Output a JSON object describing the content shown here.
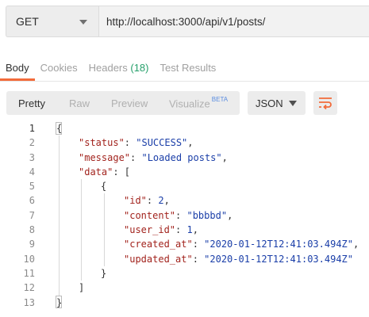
{
  "request": {
    "method": "GET",
    "url": "http://localhost:3000/api/v1/posts/"
  },
  "tabs": [
    {
      "label": "Body"
    },
    {
      "label": "Cookies"
    },
    {
      "label": "Headers",
      "count": "(18)"
    },
    {
      "label": "Test Results"
    }
  ],
  "view_modes": {
    "pretty": "Pretty",
    "raw": "Raw",
    "preview": "Preview",
    "visualize": "Visualize",
    "visualize_badge": "BETA"
  },
  "format": "JSON",
  "colors": {
    "accent": "#f26b3a",
    "count": "#26a06b",
    "key": "#a2231d",
    "value": "#1a3ea8"
  },
  "response": {
    "status_key": "\"status\"",
    "status_val": "\"SUCCESS\"",
    "message_key": "\"message\"",
    "message_val": "\"Loaded posts\"",
    "data_key": "\"data\"",
    "id_key": "\"id\"",
    "id_val": "2",
    "content_key": "\"content\"",
    "content_val": "\"bbbbd\"",
    "user_id_key": "\"user_id\"",
    "user_id_val": "1",
    "created_at_key": "\"created_at\"",
    "created_at_val": "\"2020-01-12T12:41:03.494Z\"",
    "updated_at_key": "\"updated_at\"",
    "updated_at_val": "\"2020-01-12T12:41:03.494Z\""
  },
  "line_numbers": [
    "1",
    "2",
    "3",
    "4",
    "5",
    "6",
    "7",
    "8",
    "9",
    "10",
    "11",
    "12",
    "13"
  ]
}
